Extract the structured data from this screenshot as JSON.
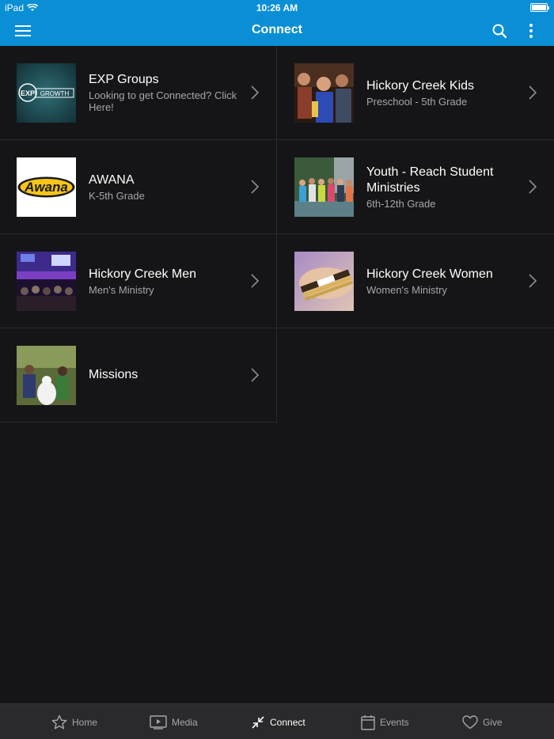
{
  "status": {
    "device": "iPad",
    "time": "10:26 AM"
  },
  "nav": {
    "title": "Connect"
  },
  "items": [
    {
      "title": "EXP Groups",
      "subtitle": "Looking to get Connected? Click Here!",
      "thumb": "exp-growth"
    },
    {
      "title": "Hickory Creek Kids",
      "subtitle": "Preschool - 5th Grade",
      "thumb": "kids-photo"
    },
    {
      "title": "AWANA",
      "subtitle": "K-5th Grade",
      "thumb": "awana-logo",
      "logo_text": "Awana"
    },
    {
      "title": "Youth - Reach Student Ministries",
      "subtitle": "6th-12th Grade",
      "thumb": "youth-photo"
    },
    {
      "title": "Hickory Creek Men",
      "subtitle": "Men's Ministry",
      "thumb": "men-photo"
    },
    {
      "title": "Hickory Creek Women",
      "subtitle": "Women's Ministry",
      "thumb": "women-photo"
    },
    {
      "title": "Missions",
      "subtitle": "",
      "thumb": "missions-photo"
    }
  ],
  "exp_logo": {
    "left": "EXP",
    "right": "GROWTH"
  },
  "tabs": [
    {
      "label": "Home",
      "icon": "star-icon"
    },
    {
      "label": "Media",
      "icon": "media-icon"
    },
    {
      "label": "Connect",
      "icon": "connect-icon",
      "active": true
    },
    {
      "label": "Events",
      "icon": "calendar-icon"
    },
    {
      "label": "Give",
      "icon": "heart-icon"
    }
  ],
  "colors": {
    "accent": "#0a8fd6",
    "background": "#151517",
    "tabbar": "#2a2a2c"
  }
}
